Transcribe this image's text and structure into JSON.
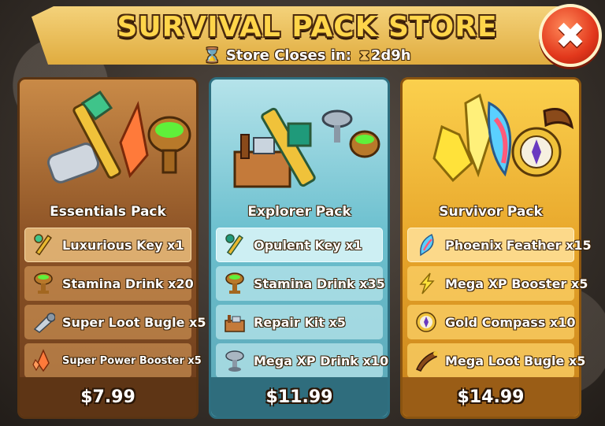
{
  "header": {
    "title": "SURVIVAL PACK STORE",
    "closes_label": "Store Closes in:",
    "closes_value": "2d9h"
  },
  "close_button": {
    "glyph": "✖"
  },
  "packs": [
    {
      "name": "Essentials Pack",
      "accent": "#8f5527",
      "items": [
        {
          "label": "Luxurious Key x1",
          "icon": "key-icon"
        },
        {
          "label": "Stamina Drink x20",
          "icon": "goblet-icon"
        },
        {
          "label": "Super Loot Bugle x5",
          "icon": "bugle-icon"
        },
        {
          "label": "Super Power Booster x5",
          "icon": "crystal-icon"
        }
      ],
      "price": "$7.99"
    },
    {
      "name": "Explorer Pack",
      "accent": "#6cc0cf",
      "items": [
        {
          "label": "Opulent Key x1",
          "icon": "key-icon"
        },
        {
          "label": "Stamina Drink x35",
          "icon": "goblet-icon"
        },
        {
          "label": "Repair Kit x5",
          "icon": "toolbox-icon"
        },
        {
          "label": "Mega XP Drink x10",
          "icon": "cup-icon"
        }
      ],
      "price": "$11.99"
    },
    {
      "name": "Survivor Pack",
      "accent": "#e7a52a",
      "items": [
        {
          "label": "Phoenix Feather x15",
          "icon": "feather-icon"
        },
        {
          "label": "Mega XP Booster x5",
          "icon": "lightning-icon"
        },
        {
          "label": "Gold Compass x10",
          "icon": "compass-icon"
        },
        {
          "label": "Mega Loot Bugle x5",
          "icon": "horn-icon"
        }
      ],
      "price": "$14.99"
    }
  ]
}
